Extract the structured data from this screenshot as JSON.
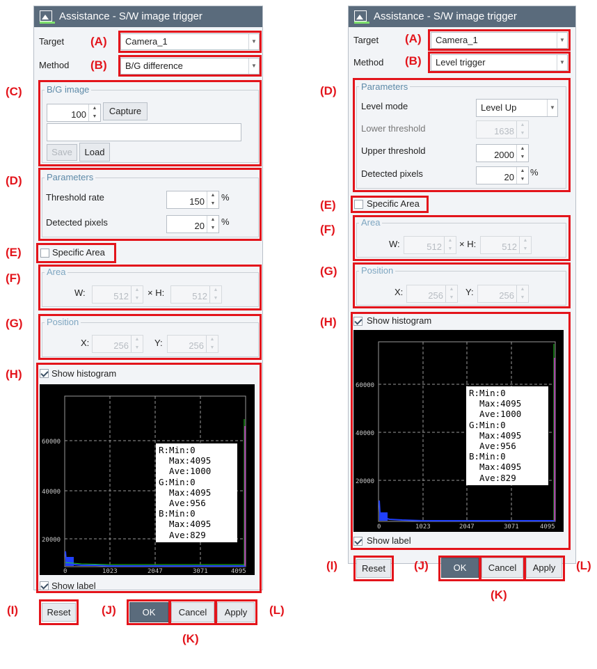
{
  "dialog": {
    "title": "Assistance - S/W image trigger",
    "target_label": "Target",
    "method_label": "Method",
    "ok": "OK",
    "cancel": "Cancel",
    "apply": "Apply",
    "reset": "Reset",
    "show_histogram": "Show histogram",
    "show_label": "Show label",
    "specific_area": "Specific Area",
    "area_group": "Area",
    "position_group": "Position",
    "parameters_group": "Parameters",
    "w_label": "W:",
    "h_label": "× H:",
    "x_label": "X:",
    "y_label": "Y:",
    "percent": "%"
  },
  "left": {
    "target_value": "Camera_1",
    "method_value": "B/G difference",
    "bg_group": "B/G image",
    "bg_count": "100",
    "capture": "Capture",
    "path_value": "",
    "save": "Save",
    "load": "Load",
    "threshold_rate_label": "Threshold rate",
    "threshold_rate_value": "150",
    "detected_pixels_label": "Detected pixels",
    "detected_pixels_value": "20",
    "area_w": "512",
    "area_h": "512",
    "pos_x": "256",
    "pos_y": "256"
  },
  "right": {
    "target_value": "Camera_1",
    "method_value": "Level trigger",
    "level_mode_label": "Level mode",
    "level_mode_value": "Level Up",
    "lower_threshold_label": "Lower threshold",
    "lower_threshold_value": "1638",
    "upper_threshold_label": "Upper threshold",
    "upper_threshold_value": "2000",
    "detected_pixels_label": "Detected pixels",
    "detected_pixels_value": "20",
    "area_w": "512",
    "area_h": "512",
    "pos_x": "256",
    "pos_y": "256"
  },
  "histogram": {
    "y_ticks": [
      "60000",
      "40000",
      "20000"
    ],
    "x_ticks": [
      "0",
      "1023",
      "2047",
      "3071",
      "4095"
    ],
    "info_text": "R:Min:0\n  Max:4095\n  Ave:1000\nG:Min:0\n  Max:4095\n  Ave:956\nB:Min:0\n  Max:4095\n  Ave:829",
    "colors": {
      "red": "#ff2020",
      "green": "#20d020",
      "blue": "#2040ff",
      "grid": "#9a9a9a"
    }
  },
  "annotations": {
    "A": "(A)",
    "B": "(B)",
    "C": "(C)",
    "D": "(D)",
    "E": "(E)",
    "F": "(F)",
    "G": "(G)",
    "H": "(H)",
    "I": "(I)",
    "J": "(J)",
    "K": "(K)",
    "L": "(L)"
  },
  "colors": {
    "annotation_red": "#e3141b",
    "titlebar": "#5a6b7c",
    "group_title": "#5e8aa8"
  }
}
